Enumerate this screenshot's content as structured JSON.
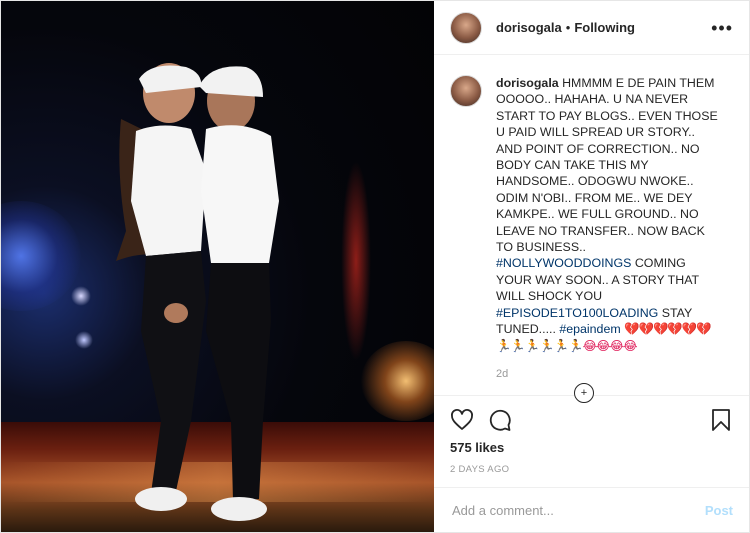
{
  "header": {
    "username": "dorisogala",
    "separator": "•",
    "follow_status": "Following",
    "more_icon": "more-horizontal-icon"
  },
  "caption": {
    "username": "dorisogala",
    "text_part1": "HMMMM E DE PAIN THEM OOOOO.. HAHAHA. U NA NEVER START TO PAY BLOGS.. EVEN THOSE U PAID WILL SPREAD UR STORY.. AND POINT OF CORRECTION.. NO BODY CAN TAKE THIS MY HANDSOME.. ODOGWU NWOKE.. ODIM N'OBI.. FROM ME.. WE DEY KAMKPE.. WE FULL GROUND.. NO LEAVE NO TRANSFER.. NOW BACK TO BUSINESS..",
    "hashtag1": "#NOLLYWOODDOINGS",
    "text_part2": "COMING YOUR WAY SOON.. A STORY THAT WILL SHOCK YOU",
    "hashtag2": "#EPISODE1TO100LOADING",
    "text_part3": "STAY TUNED.....",
    "hashtag3": "#epaindem",
    "emojis": "💔💔💔💔💔💔🏃🏃🏃🏃🏃🏃😂😂😂😂",
    "time_ago": "2d"
  },
  "actions": {
    "like_icon": "heart-icon",
    "comment_icon": "comment-icon",
    "save_icon": "bookmark-icon",
    "likes": "575 likes",
    "date": "2 DAYS AGO"
  },
  "comment_box": {
    "placeholder": "Add a comment...",
    "post_label": "Post"
  },
  "colors": {
    "hashtag": "#003569",
    "muted": "#999999",
    "post_button": "#b2dffc"
  }
}
